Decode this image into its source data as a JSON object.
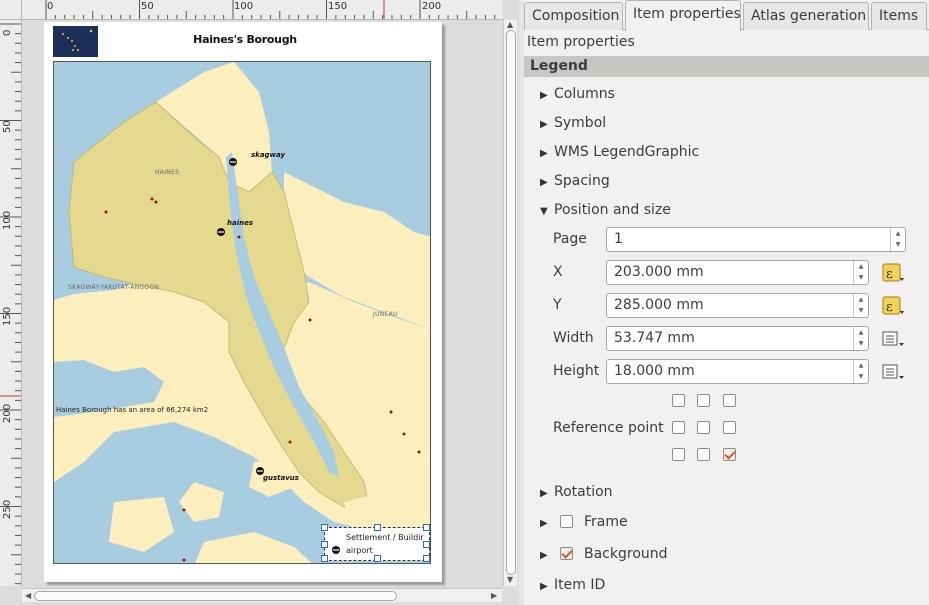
{
  "rulers": {
    "top": [
      "0",
      "50",
      "100",
      "150",
      "200"
    ],
    "left": [
      "0",
      "50",
      "100",
      "150",
      "200",
      "250"
    ]
  },
  "map": {
    "title": "Haines's Borough",
    "region_labels": [
      "HAINES",
      "SKAGWAY-YAKUTAT-ANGOON",
      "JUNEAU"
    ],
    "towns": [
      "skagway",
      "haines",
      "gustavus"
    ],
    "area_note": "Haines Borough has an area of 66,274 km2",
    "legend": [
      "Settlement / Buildir",
      "airport"
    ],
    "colors": {
      "water": "#a9cde0",
      "land": "#fdefbd",
      "borough": "#e5d98f"
    }
  },
  "tabs": [
    "Composition",
    "Item properties",
    "Atlas generation",
    "Items"
  ],
  "panel": {
    "heading": "Item properties",
    "section": "Legend",
    "groups_top": [
      "Columns",
      "Symbol",
      "WMS LegendGraphic",
      "Spacing"
    ],
    "position_group": "Position and size",
    "page_label": "Page",
    "page_value": "1",
    "x_label": "X",
    "x_value": "203.000 mm",
    "y_label": "Y",
    "y_value": "285.000 mm",
    "width_label": "Width",
    "width_value": "53.747 mm",
    "height_label": "Height",
    "height_value": "18.000 mm",
    "reference_label": "Reference point",
    "reference_selected": "bottom-right",
    "rotation": "Rotation",
    "frame": "Frame",
    "frame_checked": false,
    "background": "Background",
    "background_checked": true,
    "item_id": "Item ID"
  }
}
